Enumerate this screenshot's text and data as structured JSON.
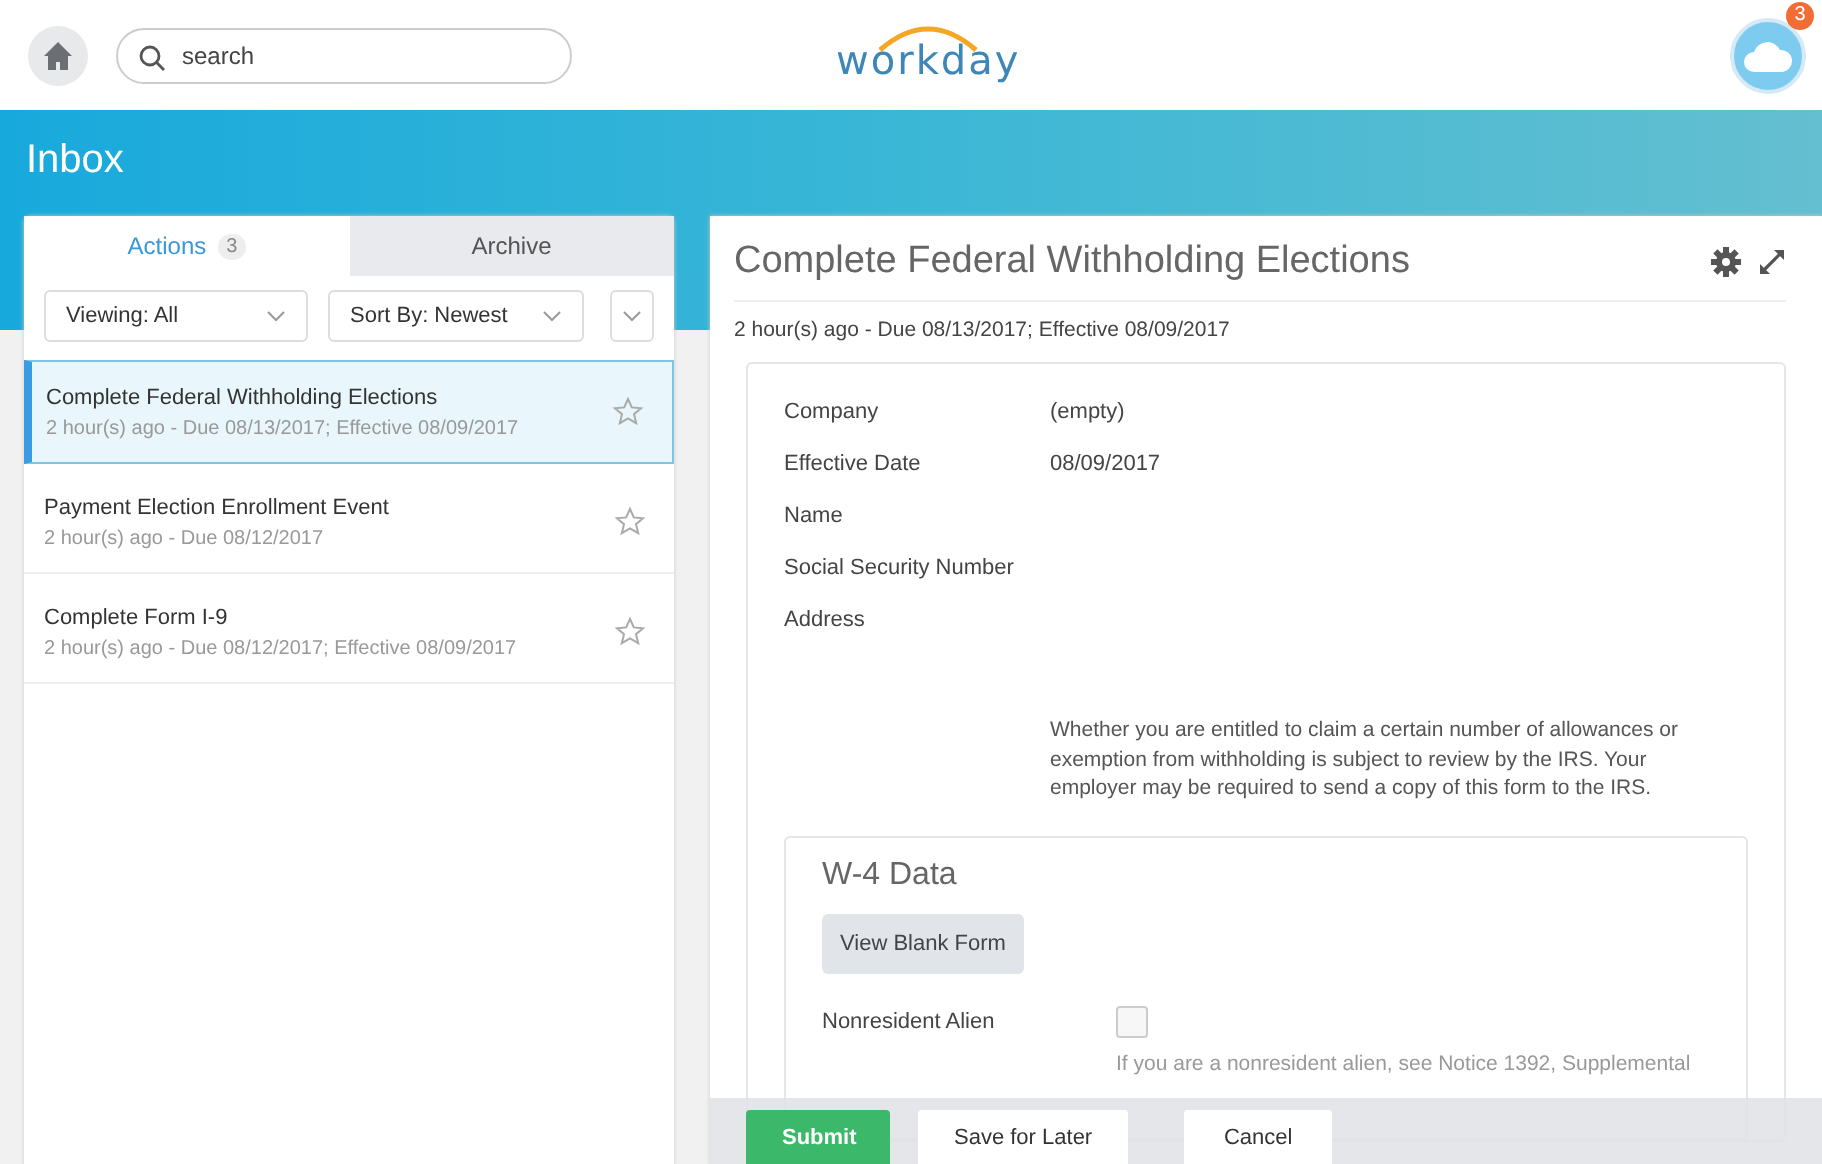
{
  "topbar": {
    "search": {
      "placeholder": "search"
    },
    "logo": "workday",
    "notification_count": "3"
  },
  "page_title": "Inbox",
  "tabs": [
    {
      "label": "Actions",
      "count": "3",
      "selected": true
    },
    {
      "label": "Archive",
      "selected": false
    }
  ],
  "filters": [
    {
      "label": "Viewing: All"
    },
    {
      "label": "Sort By: Newest"
    }
  ],
  "inbox_items": [
    {
      "title": "Complete Federal Withholding Elections",
      "meta": "2 hour(s) ago - Due 08/13/2017; Effective 08/09/2017",
      "selected": true,
      "starred": false
    },
    {
      "title": "Payment Election Enrollment Event",
      "meta": "2 hour(s) ago - Due 08/12/2017",
      "selected": false,
      "starred": false
    },
    {
      "title": "Complete Form I-9",
      "meta": "2 hour(s) ago - Due 08/12/2017; Effective 08/09/2017",
      "selected": false,
      "starred": false
    }
  ],
  "detail": {
    "title": "Complete Federal Withholding Elections",
    "subtitle": "2 hour(s) ago - Due 08/13/2017; Effective 08/09/2017",
    "fields": [
      {
        "label": "Company",
        "value": "(empty)"
      },
      {
        "label": "Effective Date",
        "value": "08/09/2017"
      },
      {
        "label": "Name"
      },
      {
        "label": "Social Security Number"
      },
      {
        "label": "Address"
      }
    ],
    "notice": "Whether you are entitled to claim a certain number of allowances or exemption from withholding is subject to review by the IRS. Your employer may be required to send a copy of this form to the IRS.",
    "section": {
      "title": "W-4 Data",
      "button": "View Blank Form",
      "checkbox": {
        "label": "Nonresident Alien",
        "checked": false
      },
      "note_lines": [
        "If you are a nonresident alien, see Notice 1392, Supplemental"
      ]
    }
  },
  "footer_buttons": [
    {
      "label": "Submit",
      "kind": "primary"
    },
    {
      "label": "Save for Later",
      "kind": "secondary"
    },
    {
      "label": "Cancel",
      "kind": "secondary"
    }
  ]
}
